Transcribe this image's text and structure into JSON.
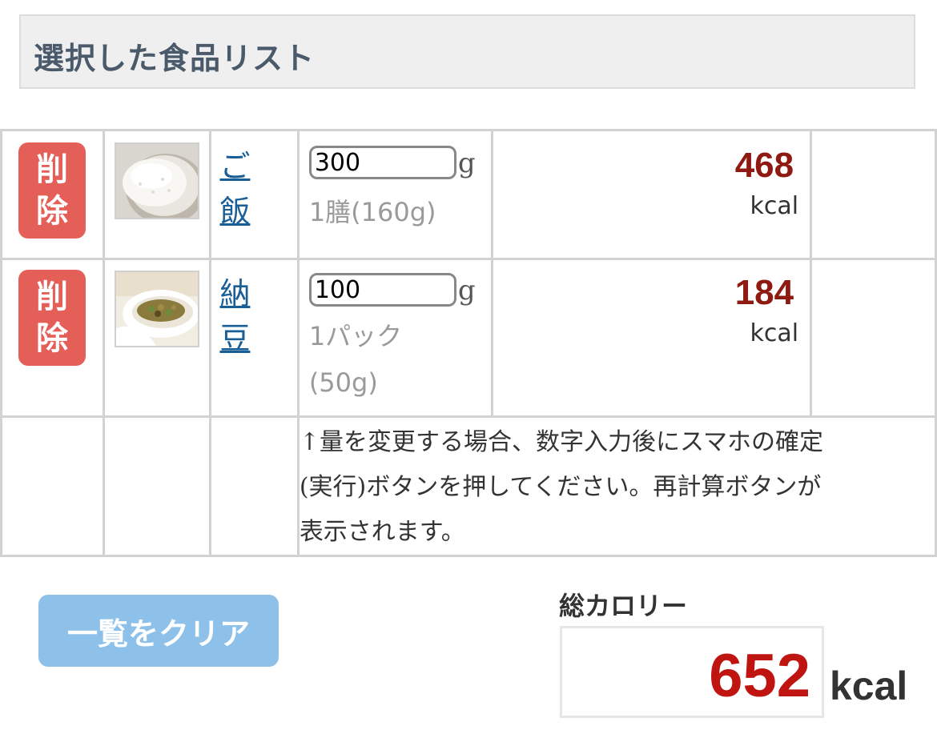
{
  "header": {
    "title": "選択した食品リスト"
  },
  "items": [
    {
      "delete_label_1": "削",
      "delete_label_2": "除",
      "name_1": "ご",
      "name_2": "飯",
      "quantity": "300",
      "unit": "g",
      "portion": "1膳(160g)",
      "kcal": "468",
      "kcal_unit": "kcal"
    },
    {
      "delete_label_1": "削",
      "delete_label_2": "除",
      "name_1": "納",
      "name_2": "豆",
      "quantity": "100",
      "unit": "g",
      "portion_1": "1パック",
      "portion_2": "(50g)",
      "kcal": "184",
      "kcal_unit": "kcal"
    }
  ],
  "note": {
    "line1": "↑量を変更する場合、数字入力後にスマホの確定",
    "line2": "(実行)ボタンを押してください。再計算ボタンが",
    "line3": "表示されます。"
  },
  "clear_button": "一覧をクリア",
  "total": {
    "label": "総カロリー",
    "value": "652",
    "unit": "kcal"
  },
  "colors": {
    "delete_button": "#e55f59",
    "clear_button": "#8ec1ea",
    "kcal_item": "#8e1a12",
    "kcal_total": "#c01410",
    "link": "#1a5e96"
  }
}
